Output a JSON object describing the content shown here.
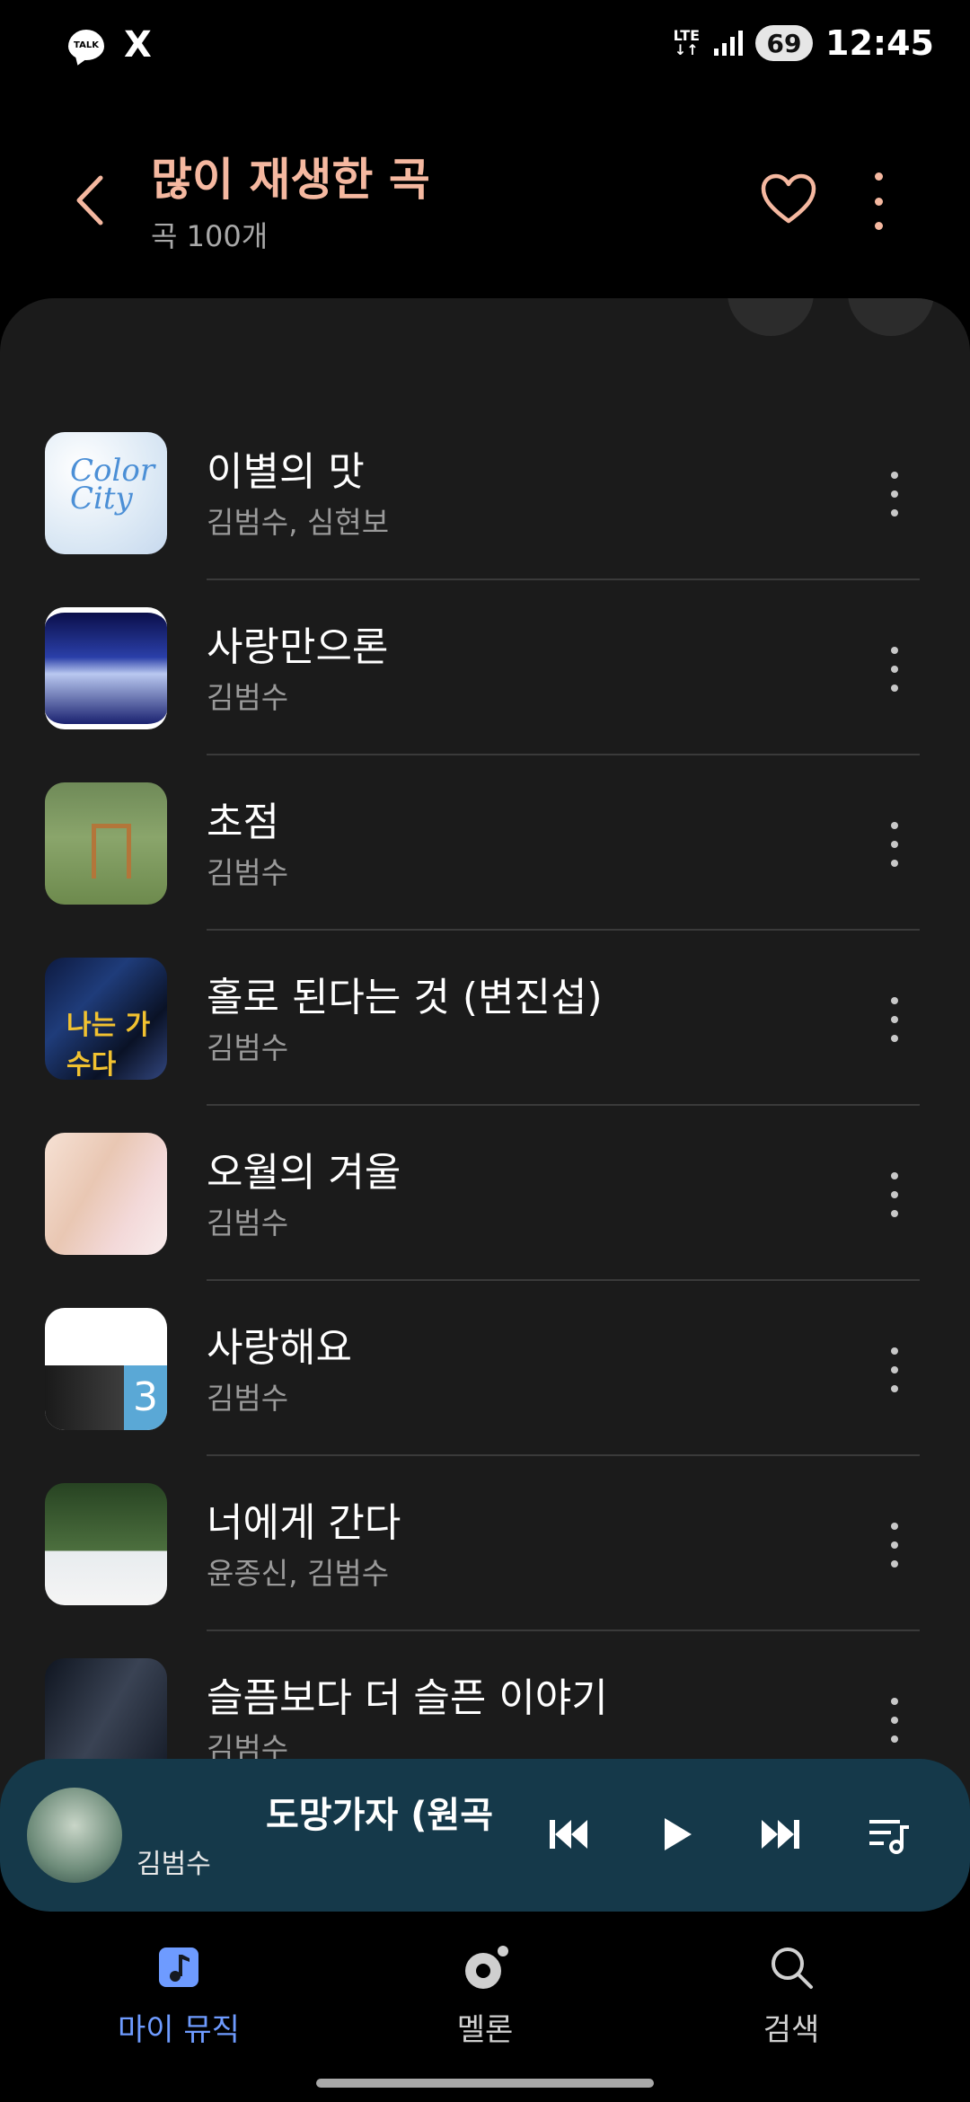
{
  "status_bar": {
    "kakao_label": "TALK",
    "x_label": "X",
    "network": "LTE",
    "battery": "69",
    "time": "12:45"
  },
  "header": {
    "title": "많이 재생한 곡",
    "subtitle": "곡 100개",
    "accent_color": "#f5b8a0"
  },
  "songs": [
    {
      "title": "이별의 맛",
      "artist": "김범수, 심현보",
      "art_text": "Color City"
    },
    {
      "title": "사랑만으론",
      "artist": "김범수"
    },
    {
      "title": "초점",
      "artist": "김범수"
    },
    {
      "title": "홀로 된다는 것 (변진섭)",
      "artist": "김범수",
      "art_text": "나는 가수다"
    },
    {
      "title": "오월의 겨울",
      "artist": "김범수"
    },
    {
      "title": "사랑해요",
      "artist": "김범수"
    },
    {
      "title": "너에게 간다",
      "artist": "윤종신, 김범수"
    },
    {
      "title": "슬픔보다 더 슬픈 이야기",
      "artist": "김범수"
    }
  ],
  "mini_player": {
    "title": "도망가자 (원곡 ",
    "artist": "김범수",
    "background_color": "#15394a"
  },
  "bottom_nav": {
    "my_music": "마이 뮤직",
    "melon": "멜론",
    "search": "검색",
    "active_color": "#6e9bff"
  }
}
